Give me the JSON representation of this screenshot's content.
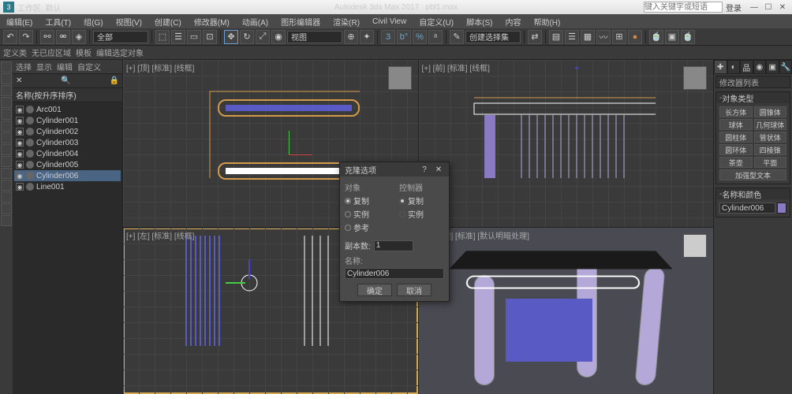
{
  "titlebar": {
    "workspace": "工作区: 默认",
    "app_title": "Autodesk 3ds Max 2017",
    "file": "pbl1.max",
    "search_placeholder": "键入关键字或短语",
    "login": "登录",
    "min": "—",
    "max": "☐",
    "close": "✕"
  },
  "menubar": [
    "编辑(E)",
    "工具(T)",
    "组(G)",
    "视图(V)",
    "创建(C)",
    "修改器(M)",
    "动画(A)",
    "图形编辑器",
    "渲染(R)",
    "Civil View",
    "自定义(U)",
    "脚本(S)",
    "内容",
    "帮助(H)"
  ],
  "toolbar2": [
    "选择",
    "显示",
    "编辑",
    "自定义"
  ],
  "toolbar2b": [
    "定义类",
    "无已应区域",
    "模板",
    "编辑选定对象"
  ],
  "combo1": "创建选择集",
  "scene": {
    "header": "名称(按升序排序)",
    "items": [
      {
        "name": "Arc001",
        "sel": false
      },
      {
        "name": "Cylinder001",
        "sel": false
      },
      {
        "name": "Cylinder002",
        "sel": false
      },
      {
        "name": "Cylinder003",
        "sel": false
      },
      {
        "name": "Cylinder004",
        "sel": false
      },
      {
        "name": "Cylinder005",
        "sel": false
      },
      {
        "name": "Cylinder006",
        "sel": true
      },
      {
        "name": "Line001",
        "sel": false
      }
    ]
  },
  "viewports": {
    "tl": "[+] [顶] [标准] [线框]",
    "tr": "[+] [前] [标准] [线框]",
    "bl": "[+] [左] [标准] [线框]",
    "br": "[+] [透视] [标准] [默认明暗处理]"
  },
  "dialog": {
    "title": "克隆选项",
    "help": "?",
    "close": "✕",
    "grp1_label": "对象",
    "grp2_label": "控制器",
    "opt_copy": "复制",
    "opt_inst": "实例",
    "opt_ref": "参考",
    "copies_label": "副本数:",
    "copies_val": "1",
    "name_label": "名称:",
    "name_val": "Cylinder006",
    "ok": "确定",
    "cancel": "取消"
  },
  "cmd": {
    "hdr_mod": "修改器列表",
    "sec1": "对象类型",
    "btns1": [
      "长方体",
      "圆锥体",
      "球体",
      "几何球体",
      "圆柱体",
      "管状体",
      "圆环体",
      "四棱锥",
      "茶壶",
      "平面",
      "加强型文本"
    ],
    "sec2": "名称和颜色",
    "name_val": "Cylinder006"
  }
}
